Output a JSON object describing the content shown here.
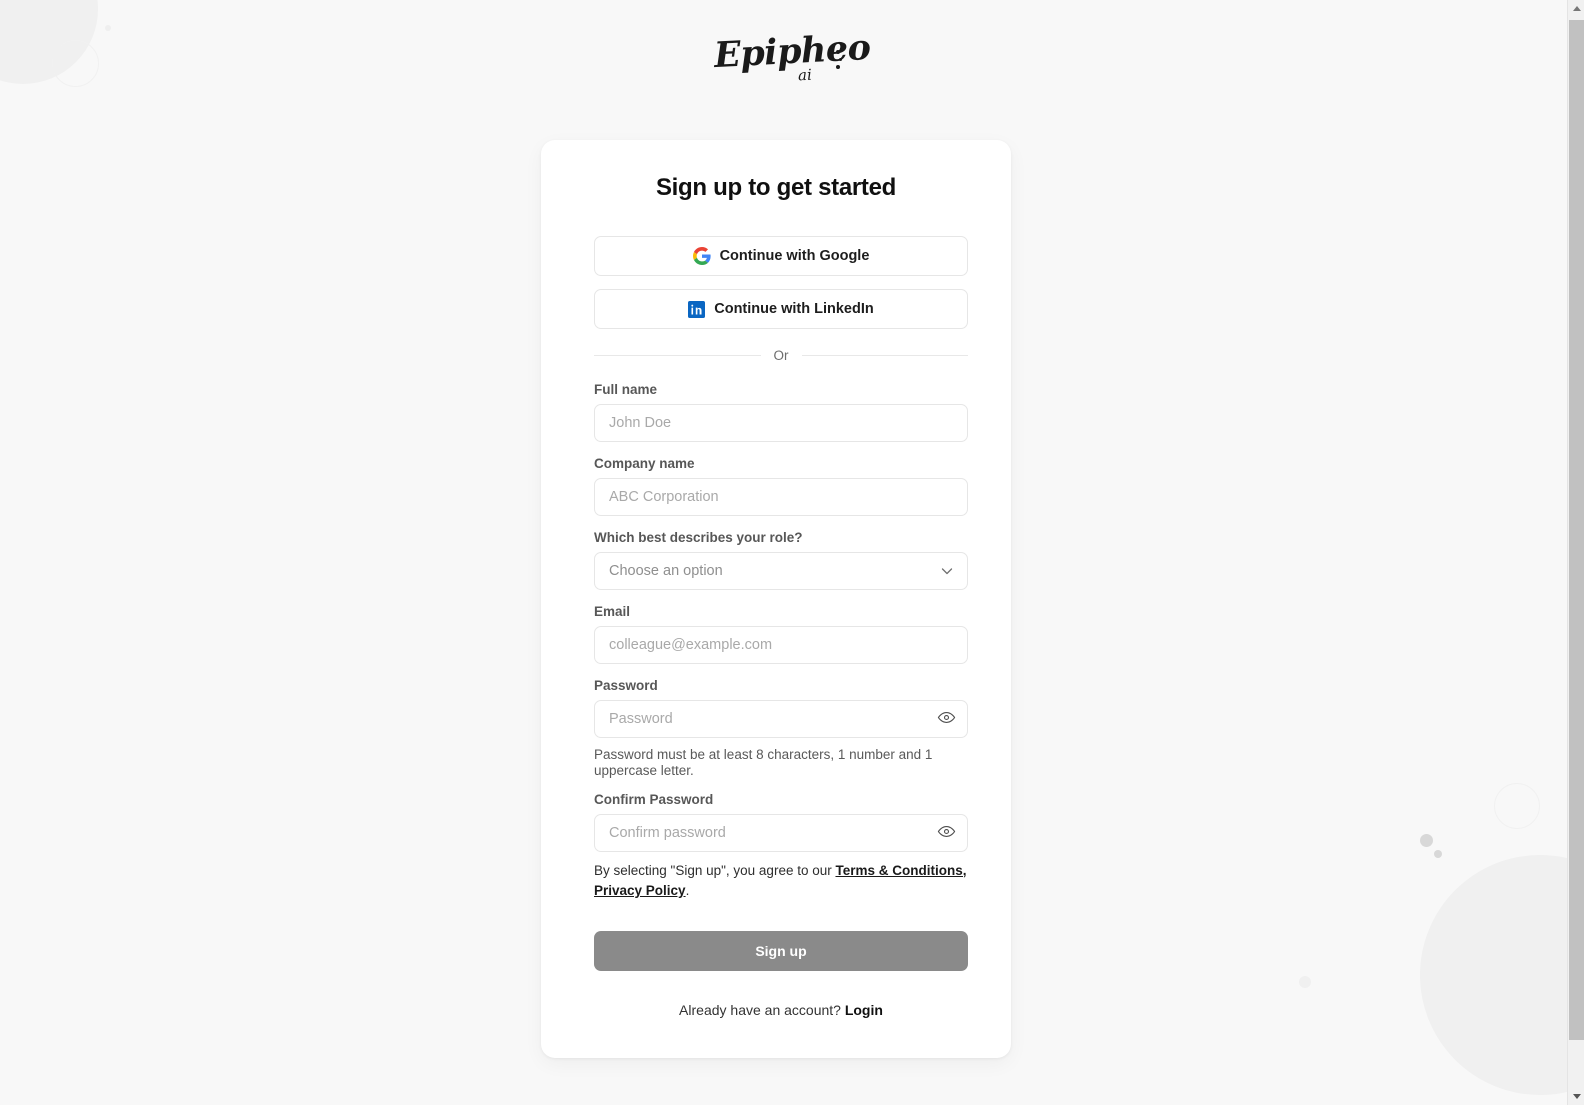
{
  "brand": {
    "logo_text": "Epipheo",
    "logo_sub": "ai"
  },
  "card": {
    "title": "Sign up to get started",
    "social": [
      {
        "label": "Continue with Google",
        "icon": "google-icon"
      },
      {
        "label": "Continue with LinkedIn",
        "icon": "linkedin-icon"
      }
    ],
    "divider_text": "Or",
    "fields": {
      "full_name": {
        "label": "Full name",
        "placeholder": "John Doe",
        "value": ""
      },
      "company_name": {
        "label": "Company name",
        "placeholder": "ABC Corporation",
        "value": ""
      },
      "role": {
        "label": "Which best describes your role?",
        "selected": "Choose an option"
      },
      "email": {
        "label": "Email",
        "placeholder": "colleague@example.com",
        "value": ""
      },
      "password": {
        "label": "Password",
        "placeholder": "Password",
        "value": ""
      },
      "confirm_password": {
        "label": "Confirm Password",
        "placeholder": "Confirm password",
        "value": ""
      }
    },
    "password_hint": "Password must be at least 8 characters, 1 number and 1 uppercase letter.",
    "terms": {
      "prefix": "By selecting \"Sign up\", you agree to our ",
      "link_terms": "Terms & Conditions,",
      "link_privacy": "Privacy Policy",
      "suffix": "."
    },
    "submit_label": "Sign up",
    "login_prompt": "Already have an account? ",
    "login_link": "Login"
  },
  "colors": {
    "page_background": "#f8f8f8",
    "card_background": "#ffffff",
    "border": "#e6e6e6",
    "submit_disabled": "#8a8a8a",
    "placeholder": "#a9a9a9",
    "linkedin_blue": "#0a66c2",
    "decor_blob": "#f0f0f0",
    "decor_dot": "#d8d8d8",
    "scrollbar_thumb": "#c1c1c1"
  }
}
